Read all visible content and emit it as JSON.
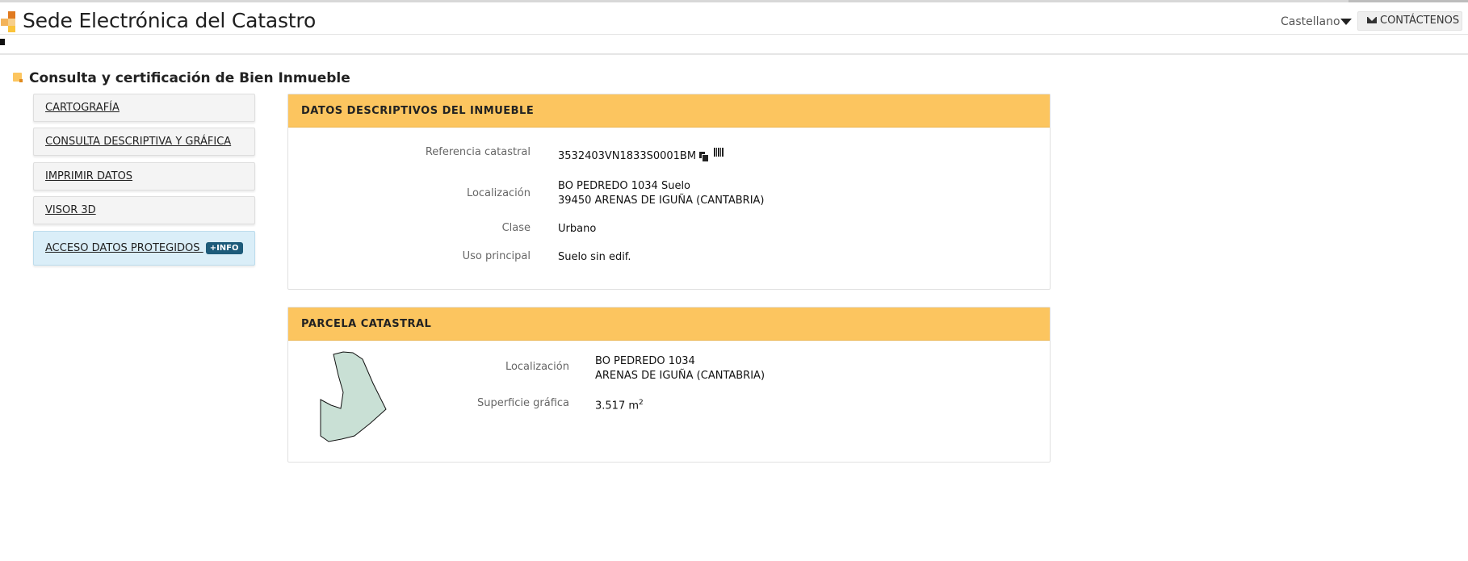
{
  "header": {
    "site_title": "Sede Electrónica del Catastro",
    "language": "Castellano",
    "contact_button": "CONTÁCTENOS"
  },
  "page": {
    "title": "Consulta y certificación de Bien Inmueble"
  },
  "sidebar": {
    "items": [
      {
        "label": "CARTOGRAFÍA"
      },
      {
        "label": "CONSULTA DESCRIPTIVA Y GRÁFICA"
      },
      {
        "label": "IMPRIMIR DATOS"
      },
      {
        "label": "VISOR 3D"
      },
      {
        "label": "ACCESO DATOS PROTEGIDOS",
        "badge": "+INFO"
      }
    ]
  },
  "datos": {
    "heading": "DATOS DESCRIPTIVOS DEL INMUEBLE",
    "ref_label": "Referencia catastral",
    "ref_value": "3532403VN1833S0001BM",
    "loc_label": "Localización",
    "loc_line1": "BO PEDREDO 1034 Suelo",
    "loc_line2": "39450 ARENAS DE IGUÑA (CANTABRIA)",
    "clase_label": "Clase",
    "clase_value": "Urbano",
    "uso_label": "Uso principal",
    "uso_value": "Suelo sin edif."
  },
  "parcela": {
    "heading": "PARCELA CATASTRAL",
    "loc_label": "Localización",
    "loc_line1": "BO PEDREDO 1034",
    "loc_line2": "ARENAS DE IGUÑA (CANTABRIA)",
    "sup_label": "Superficie gráfica",
    "sup_value": "3.517 m",
    "sup_exp": "2",
    "shape_fill": "#c9e0d5"
  },
  "colors": {
    "accent": "#fcc55f",
    "protected_bg": "#daeef8",
    "badge": "#1d5b7a"
  }
}
